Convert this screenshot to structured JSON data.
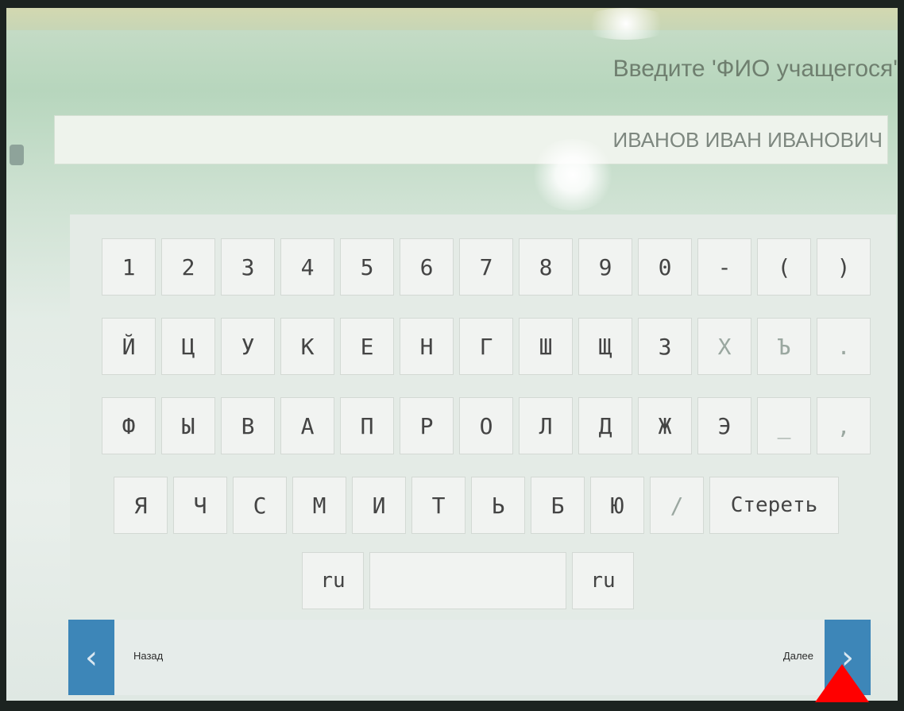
{
  "prompt": "Введите 'ФИО учащегося'",
  "name_field": {
    "value": "ИВАНОВ ИВАН ИВАНОВИЧ"
  },
  "keyboard": {
    "rows": [
      [
        "1",
        "2",
        "3",
        "4",
        "5",
        "6",
        "7",
        "8",
        "9",
        "0",
        "-",
        "(",
        ")"
      ],
      [
        "Й",
        "Ц",
        "У",
        "К",
        "Е",
        "Н",
        "Г",
        "Ш",
        "Щ",
        "З",
        "Х",
        "Ъ",
        "."
      ],
      [
        "Ф",
        "Ы",
        "В",
        "А",
        "П",
        "Р",
        "О",
        "Л",
        "Д",
        "Ж",
        "Э",
        "_",
        ","
      ],
      [
        "Я",
        "Ч",
        "С",
        "М",
        "И",
        "Т",
        "Ь",
        "Б",
        "Ю",
        "/"
      ]
    ],
    "erase_label": "Стереть",
    "lang_left": "ru",
    "space_label": "",
    "lang_right": "ru"
  },
  "nav": {
    "back_label": "Назад",
    "next_label": "Далее",
    "back_icon": "chevron-left-icon",
    "next_icon": "chevron-right-icon"
  },
  "colors": {
    "nav_button": "#3d86b8",
    "marker": "#ff0000"
  }
}
